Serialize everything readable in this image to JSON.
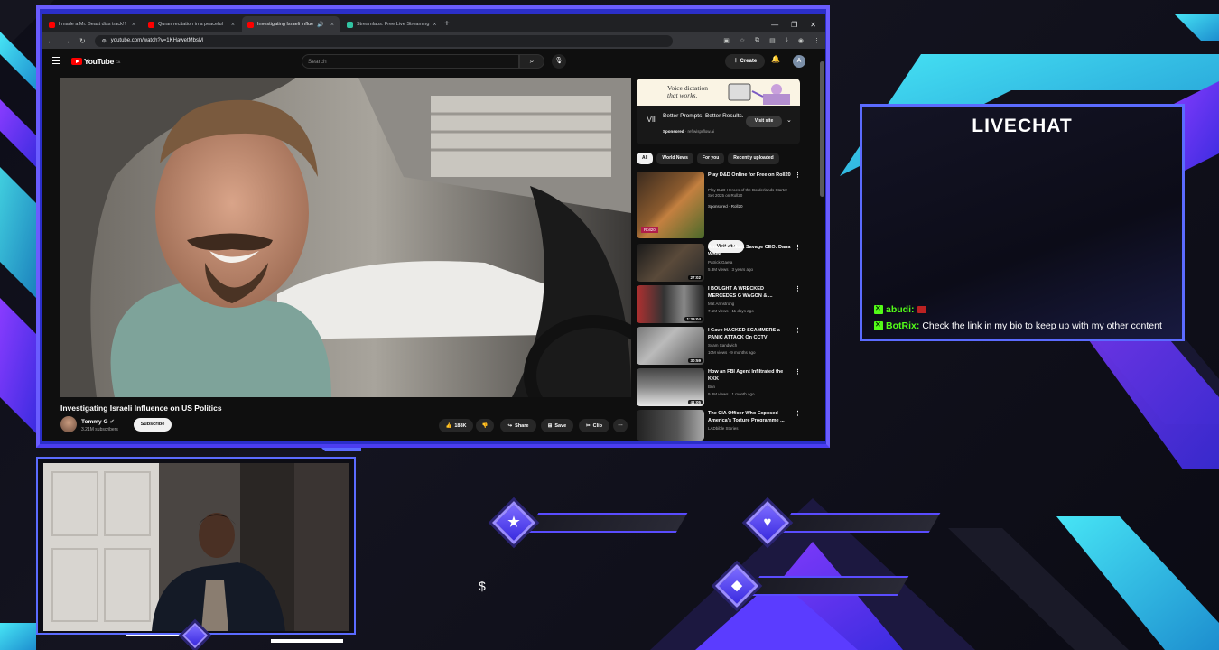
{
  "browser": {
    "tabs": [
      {
        "label": "I made a Mr. Beast diss track!!",
        "icon": "youtube-icon",
        "color": "#ff0000",
        "active": false
      },
      {
        "label": "Quran recitation in a peaceful",
        "icon": "youtube-icon",
        "color": "#ff0000",
        "active": false
      },
      {
        "label": "Investigating Israeli Influe",
        "icon": "youtube-icon",
        "color": "#ff0000",
        "active": true
      },
      {
        "label": "Streamlabs: Free Live Streaming",
        "icon": "streamlabs-icon",
        "color": "#31c3a2",
        "active": false
      }
    ],
    "new_tab": "+",
    "url": "youtube.com/watch?v=1KHawetMbsM"
  },
  "youtube": {
    "search_placeholder": "Search",
    "create_label": "Create",
    "avatar_letter": "A",
    "logo_text": "YouTube",
    "logo_region": "CA",
    "video": {
      "title": "Investigating Israeli Influence on US Politics",
      "channel": "Tommy G",
      "subscribers": "3.21M subscribers",
      "subscribe_label": "Subscribe",
      "likes": "188K",
      "share_label": "Share",
      "save_label": "Save",
      "clip_label": "Clip"
    },
    "ad": {
      "banner_text_1": "Voice dictation",
      "banner_text_2": "that works.",
      "title": "Better Prompts. Better Results.",
      "sponsored": "Sponsored",
      "domain": "ref.wisprflow.ai",
      "visit_label": "Visit site"
    },
    "chips": [
      "All",
      "World News",
      "For you",
      "Recently uploaded"
    ],
    "recommendations": [
      {
        "title": "Play D&D Online for Free on Roll20",
        "desc": "Play D&D Heroes of the Borderlands Starter Set 2025 on Roll20",
        "meta": "Sponsored · Roll20",
        "duration": "",
        "visit_label": "Visit site"
      },
      {
        "title": "America's Most Savage CEO: Dana White",
        "channel": "Patrick Gaeta",
        "meta": "5.3M views · 3 years ago",
        "duration": "27:02"
      },
      {
        "title": "I BOUGHT A WRECKED MERCEDES G WAGON & ...",
        "channel": "Mat Armstrong",
        "meta": "7.1M views · 11 days ago",
        "duration": "1:39:04"
      },
      {
        "title": "I Gave HACKED SCAMMERS a PANIC ATTACK On CCTV!",
        "channel": "Scam Sandwich",
        "meta": "10M views · 9 months ago",
        "duration": "30:59"
      },
      {
        "title": "How an FBI Agent Infiltrated the KKK",
        "channel": "Bnn",
        "meta": "9.8M views · 1 month ago",
        "duration": "41:05"
      },
      {
        "title": "The CIA Officer Who Exposed America's Torture Programme ...",
        "channel": "LADbible Stories",
        "meta": "",
        "duration": ""
      }
    ]
  },
  "livechat": {
    "title": "LIVECHAT",
    "messages": [
      {
        "user": "abudi:",
        "text": ""
      },
      {
        "user": "BotRix:",
        "text": "Check the link in my bio to keep up with my other content"
      }
    ]
  },
  "overlay": {
    "dollar_label": "$"
  },
  "colors": {
    "accent": "#5b6bff",
    "purple": "#6a3cff",
    "cyan": "#3fd6e8",
    "kick_green": "#53fc18"
  }
}
